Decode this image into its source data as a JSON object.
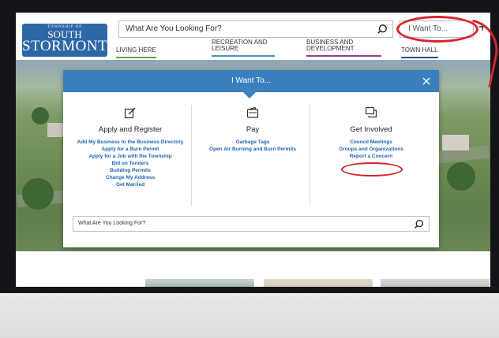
{
  "header": {
    "logo_small": "TOWNSHIP OF",
    "logo_line1": "SOUTH",
    "logo_line2": "STORMONT",
    "search_placeholder": "What Are You Looking For?",
    "i_want_label": "I Want To...",
    "plus_label": "+"
  },
  "nav": [
    {
      "label": "LIVING HERE"
    },
    {
      "label": "RECREATION AND LEISURE"
    },
    {
      "label": "BUSINESS AND DEVELOPMENT"
    },
    {
      "label": "TOWN HALL"
    }
  ],
  "modal": {
    "title": "I Want To...",
    "columns": [
      {
        "heading": "Apply and Register",
        "icon": "edit-icon",
        "links": [
          "Add My Business to the Business Directory",
          "Apply for a Burn Permit",
          "Apply for a Job with the Township",
          "Bid on Tenders",
          "Building Permits",
          "Change My Address",
          "Get Married"
        ]
      },
      {
        "heading": "Pay",
        "icon": "wallet-icon",
        "links": [
          "Garbage Tags",
          "Open Air Burning and Burn Permits"
        ]
      },
      {
        "heading": "Get Involved",
        "icon": "chat-icon",
        "links": [
          "Council Meetings",
          "Groups and Organizations",
          "Report a Concern"
        ]
      }
    ],
    "search_placeholder": "What Are You Looking For?"
  },
  "colors": {
    "brand_blue": "#3a7fbe",
    "link_blue": "#1f63b0",
    "annotation_red": "#d6252e"
  }
}
